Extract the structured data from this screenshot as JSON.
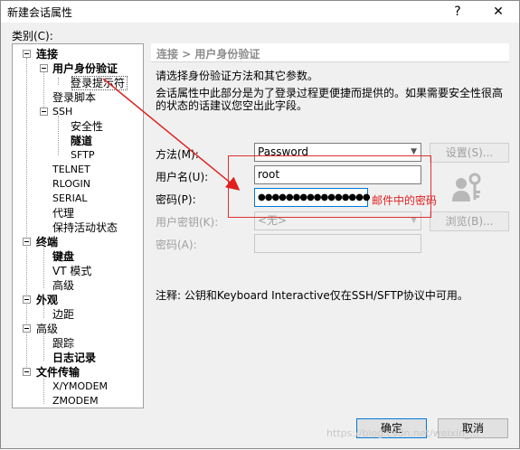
{
  "window": {
    "title": "新建会话属性",
    "help": "?",
    "close": "✕"
  },
  "category_label": "类别(C):",
  "tree": [
    {
      "label": "连接",
      "bold": true
    },
    {
      "label": "用户身份验证",
      "bold": true
    },
    {
      "label": "登录提示符",
      "bold": false
    },
    {
      "label": "登录脚本",
      "bold": false
    },
    {
      "label": "SSH",
      "bold": false
    },
    {
      "label": "安全性",
      "bold": false
    },
    {
      "label": "隧道",
      "bold": true
    },
    {
      "label": "SFTP",
      "bold": false
    },
    {
      "label": "TELNET",
      "bold": false
    },
    {
      "label": "RLOGIN",
      "bold": false
    },
    {
      "label": "SERIAL",
      "bold": false
    },
    {
      "label": "代理",
      "bold": false
    },
    {
      "label": "保持活动状态",
      "bold": false
    },
    {
      "label": "终端",
      "bold": true
    },
    {
      "label": "键盘",
      "bold": true
    },
    {
      "label": "VT 模式",
      "bold": false
    },
    {
      "label": "高级",
      "bold": false
    },
    {
      "label": "外观",
      "bold": true
    },
    {
      "label": "边距",
      "bold": false
    },
    {
      "label": "高级",
      "bold": false
    },
    {
      "label": "跟踪",
      "bold": false
    },
    {
      "label": "日志记录",
      "bold": true
    },
    {
      "label": "文件传输",
      "bold": true
    },
    {
      "label": "X/YMODEM",
      "bold": false
    },
    {
      "label": "ZMODEM",
      "bold": false
    }
  ],
  "panel": {
    "header": "连接 > 用户身份验证",
    "intro1": "请选择身份验证方法和其它参数。",
    "intro2": "会话属性中此部分是为了登录过程更便捷而提供的。如果需要安全性很高",
    "intro3": "的状态的话建议您空出此字段。",
    "method_label": "方法(M):",
    "method_value": "Password",
    "settings_button": "设置(S)...",
    "username_label": "用户名(U):",
    "username_value": "root",
    "password_label": "密码(P):",
    "password_value": "●●●●●●●●●●●●●●●●",
    "annotation": "邮件中的密码",
    "userkey_label": "用户密钥(K):",
    "userkey_value": "<无>",
    "browse_button": "浏览(B)...",
    "passphrase_label": "密码(A):",
    "note": "注释: 公钥和Keyboard Interactive仅在SSH/SFTP协议中可用。"
  },
  "buttons": {
    "ok": "确定",
    "cancel": "取消"
  },
  "watermark": "https://blog.csdn.net/weixin_..."
}
